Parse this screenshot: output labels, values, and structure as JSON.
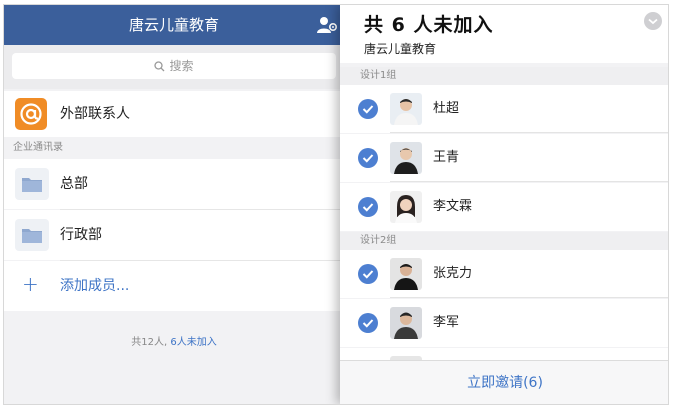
{
  "left": {
    "title": "唐云儿童教育",
    "search_placeholder": "搜索",
    "external_contacts": "外部联系人",
    "section_label": "企业通讯录",
    "departments": [
      {
        "label": "总部"
      },
      {
        "label": "行政部"
      }
    ],
    "add_member": "添加成员...",
    "footer_count": "共12人,",
    "footer_link": "6人未加入"
  },
  "right": {
    "title": "共 6 人未加入",
    "subtitle": "唐云儿童教育",
    "groups": [
      {
        "label": "设计1组",
        "members": [
          {
            "name": "杜超"
          },
          {
            "name": "王青"
          },
          {
            "name": "李文霖"
          }
        ]
      },
      {
        "label": "设计2组",
        "members": [
          {
            "name": "张克力"
          },
          {
            "name": "李军"
          }
        ]
      }
    ],
    "invite_label": "立即邀请(6)"
  },
  "colors": {
    "header_blue": "#3b5f9b",
    "accent_blue": "#3e74c6",
    "orange": "#f08c26",
    "check_blue": "#4d7fd1"
  }
}
